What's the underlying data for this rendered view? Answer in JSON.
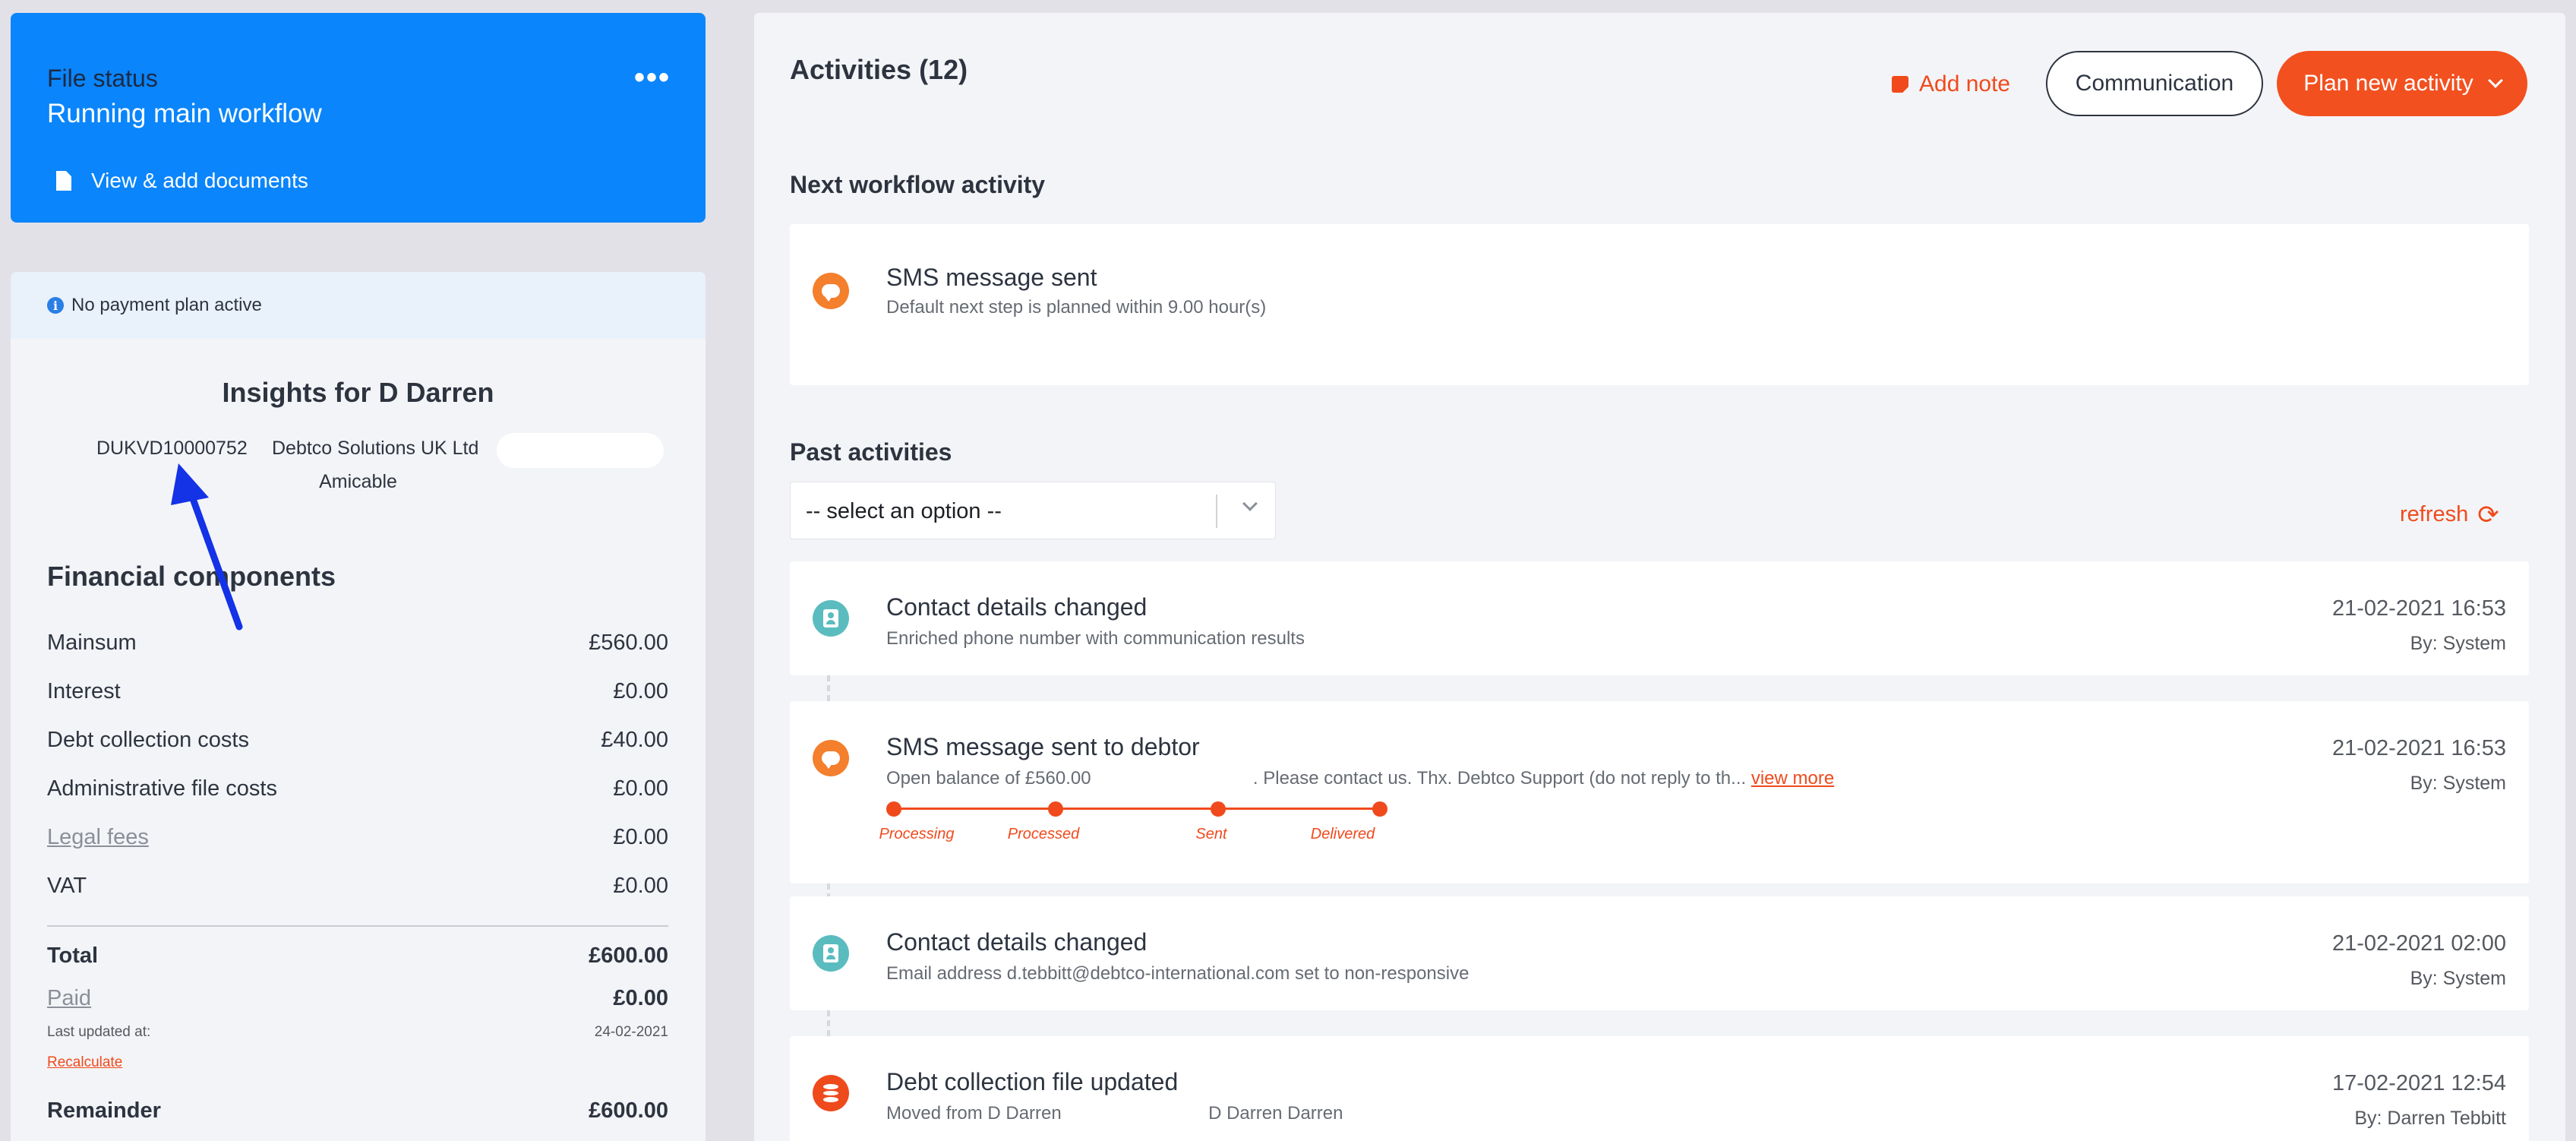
{
  "file_status": {
    "label": "File status",
    "value": "Running main workflow",
    "menu_icon": "more-dots-icon",
    "documents_link": "View & add documents"
  },
  "payment": {
    "notice": "No payment plan active"
  },
  "insights": {
    "title": "Insights for D Darren",
    "file_id": "DUKVD10000752",
    "company": "Debtco Solutions UK Ltd",
    "type": "Amicable"
  },
  "financial": {
    "title": "Financial components",
    "rows": [
      {
        "label": "Mainsum",
        "value": "£560.00"
      },
      {
        "label": "Interest",
        "value": "£0.00"
      },
      {
        "label": "Debt collection costs",
        "value": "£40.00"
      },
      {
        "label": "Administrative file costs",
        "value": "£0.00"
      },
      {
        "label": "Legal fees",
        "value": "£0.00"
      },
      {
        "label": "VAT",
        "value": "£0.00"
      }
    ],
    "total_label": "Total",
    "total_value": "£600.00",
    "paid_label": "Paid",
    "paid_value": "£0.00",
    "last_updated_label": "Last updated at:",
    "last_updated_value": "24-02-2021",
    "recalculate": "Recalculate",
    "remainder_label": "Remainder",
    "remainder_value": "£600.00"
  },
  "activities": {
    "title": "Activities (12)",
    "add_note": "Add note",
    "communication": "Communication",
    "plan_new": "Plan new activity",
    "next_title": "Next workflow activity",
    "next": {
      "title": "SMS message sent",
      "sub": "Default next step is planned within 9.00 hour(s)"
    },
    "past_title": "Past activities",
    "select_placeholder": "-- select an option --",
    "refresh": "refresh",
    "items": [
      {
        "title": "Contact details changed",
        "sub": "Enriched phone number with communication results",
        "date": "21-02-2021 16:53",
        "by": "By: System"
      },
      {
        "title": "SMS message sent to debtor",
        "sub_a": "Open balance of £560.00",
        "sub_b": ". Please contact us. Thx. Debtco Support (do not reply to th...",
        "view_more": "view more",
        "date": "21-02-2021 16:53",
        "by": "By: System",
        "steps": [
          "Processing",
          "Processed",
          "Sent",
          "Delivered"
        ]
      },
      {
        "title": "Contact details changed",
        "sub": "Email address d.tebbitt@debtco-international.com set to non-responsive",
        "date": "21-02-2021 02:00",
        "by": "By: System"
      },
      {
        "title": "Debt collection file updated",
        "sub_a": "Moved from D Darren",
        "sub_b": "D Darren Darren",
        "date": "17-02-2021 12:54",
        "by": "By: Darren Tebbitt"
      }
    ]
  },
  "colors": {
    "primary_blue": "#0a85fb",
    "accent_orange": "#f2501f",
    "annotation_arrow": "#1432e6"
  }
}
